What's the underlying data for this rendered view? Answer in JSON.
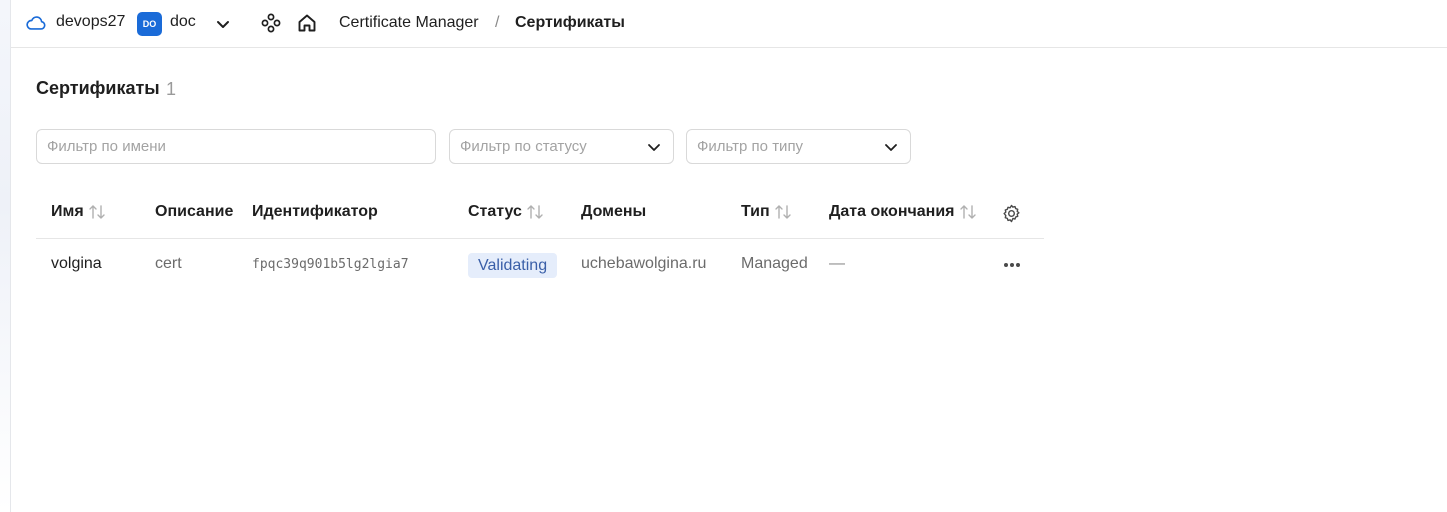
{
  "header": {
    "cloud_name": "devops27",
    "folder_badge": "DO",
    "folder_name": "doc",
    "breadcrumb": {
      "service": "Certificate Manager",
      "separator": "/",
      "current": "Сертификаты"
    }
  },
  "page": {
    "title": "Сертификаты",
    "count": "1"
  },
  "filters": {
    "name_placeholder": "Фильтр по имени",
    "status_placeholder": "Фильтр по статусу",
    "type_placeholder": "Фильтр по типу"
  },
  "table": {
    "columns": [
      "Имя",
      "Описание",
      "Идентификатор",
      "Статус",
      "Домены",
      "Тип",
      "Дата окончания"
    ],
    "rows": [
      {
        "name": "volgina",
        "description": "cert",
        "id": "fpqc39q901b5lg2lgia7",
        "status": "Validating",
        "domains": "uchebawolgina.ru",
        "type": "Managed",
        "expiry": "—"
      }
    ]
  },
  "colors": {
    "accent": "#1a6bd8",
    "status_bg": "#e5edfb",
    "status_text": "#3a5fa8"
  }
}
